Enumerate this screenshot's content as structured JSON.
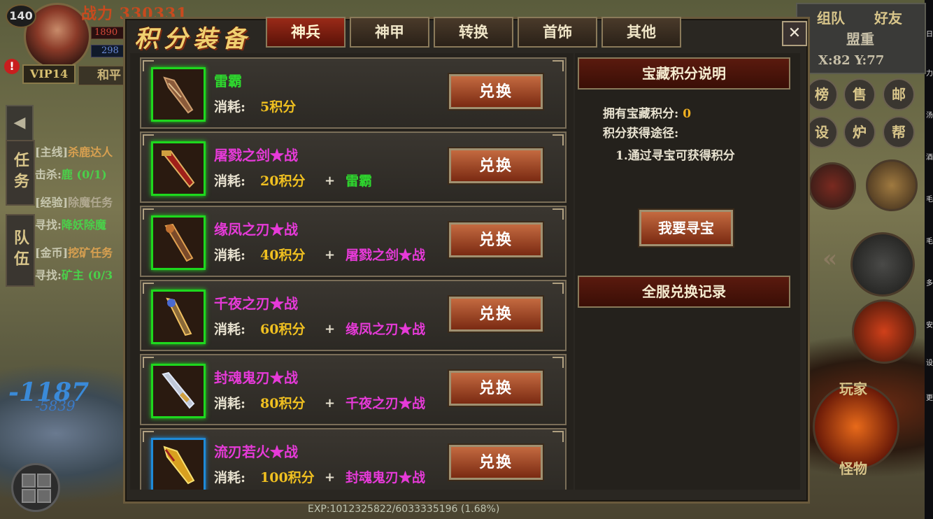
{
  "hud": {
    "level": "140",
    "power": "战力 330331",
    "hp": "1890",
    "mp": "298",
    "vip": "VIP14",
    "mode": "和平",
    "alert": "!",
    "side_tabs": [
      "任务",
      "队伍"
    ],
    "quests": [
      {
        "tag": "[主线]",
        "text": "杀鹿达人"
      },
      {
        "tag": "击杀:",
        "text": "鹿 (0/1)"
      },
      {
        "tag": "[经验]",
        "text": "除魔任务"
      },
      {
        "tag": "寻找:",
        "text": "降妖除魔"
      },
      {
        "tag": "[金币]",
        "text": "挖矿任务"
      },
      {
        "tag": "寻找:",
        "text": "矿主 (0/3"
      }
    ],
    "damage_big": "-1187",
    "damage_small": "-5839",
    "exp": "EXP:1012325822/6033335196 (1.68%)"
  },
  "right_hud": {
    "team": "组队",
    "friend": "好友",
    "name": "盟重",
    "coords": "X:82 Y:77",
    "buttons": [
      "榜",
      "售",
      "邮",
      "设",
      "炉",
      "帮"
    ],
    "player_label": "玩家",
    "monster_label": "怪物",
    "strip": [
      "日",
      "力",
      "汤",
      "酒",
      "毛",
      "毛",
      "多",
      "安",
      "设",
      "更"
    ]
  },
  "panel": {
    "title": "积分装备",
    "tabs": [
      "神兵",
      "神甲",
      "转换",
      "首饰",
      "其他"
    ],
    "active_tab": 0,
    "close": "✕",
    "cost_label": "消耗:",
    "exchange_label": "兑换",
    "plus": "+",
    "items": [
      {
        "name": "雷霸",
        "name_color": "#2ed82e",
        "cost": "5积分",
        "requires": "",
        "req_color": "#2ed82e",
        "frame": "green"
      },
      {
        "name": "屠戮之剑★战",
        "name_color": "#e63ad8",
        "cost": "20积分",
        "requires": "雷霸",
        "req_color": "#2ed82e",
        "frame": "green"
      },
      {
        "name": "缘凤之刃★战",
        "name_color": "#e63ad8",
        "cost": "40积分",
        "requires": "屠戮之剑★战",
        "req_color": "#e63ad8",
        "frame": "green"
      },
      {
        "name": "千夜之刃★战",
        "name_color": "#e63ad8",
        "cost": "60积分",
        "requires": "缘凤之刃★战",
        "req_color": "#e63ad8",
        "frame": "green"
      },
      {
        "name": "封魂鬼刃★战",
        "name_color": "#e63ad8",
        "cost": "80积分",
        "requires": "千夜之刃★战",
        "req_color": "#e63ad8",
        "frame": "green"
      },
      {
        "name": "流刃若火★战",
        "name_color": "#e63ad8",
        "cost": "100积分",
        "requires": "封魂鬼刃★战",
        "req_color": "#e63ad8",
        "frame": "blue"
      }
    ],
    "info": {
      "header": "宝藏积分说明",
      "owned_label": "拥有宝藏积分:",
      "owned_value": "0",
      "source_label": "积分获得途径:",
      "source_1": "1.通过寻宝可获得积分",
      "seek_button": "我要寻宝",
      "record_header": "全服兑换记录"
    }
  }
}
